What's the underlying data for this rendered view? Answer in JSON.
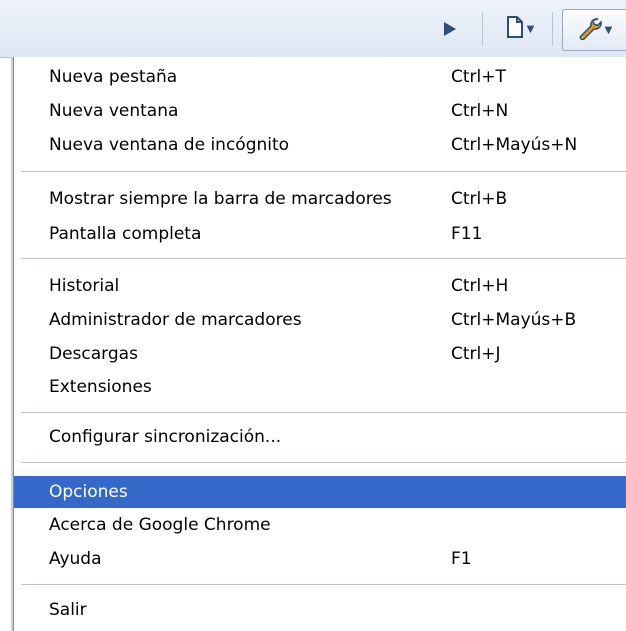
{
  "toolbar": {
    "icons": [
      "play-icon",
      "page-icon",
      "wrench-icon"
    ]
  },
  "menu": {
    "groups": [
      [
        {
          "label": "Nueva pestaña",
          "shortcut": "Ctrl+T"
        },
        {
          "label": "Nueva ventana",
          "shortcut": "Ctrl+N"
        },
        {
          "label": "Nueva ventana de incógnito",
          "shortcut": "Ctrl+Mayús+N"
        }
      ],
      [
        {
          "label": "Mostrar siempre la barra de marcadores",
          "shortcut": "Ctrl+B"
        },
        {
          "label": "Pantalla completa",
          "shortcut": "F11"
        }
      ],
      [
        {
          "label": "Historial",
          "shortcut": "Ctrl+H"
        },
        {
          "label": "Administrador de marcadores",
          "shortcut": "Ctrl+Mayús+B"
        },
        {
          "label": "Descargas",
          "shortcut": "Ctrl+J"
        },
        {
          "label": "Extensiones",
          "shortcut": ""
        }
      ],
      [
        {
          "label": "Configurar sincronización...",
          "shortcut": ""
        }
      ],
      [
        {
          "label": "Opciones",
          "shortcut": "",
          "highlighted": true
        },
        {
          "label": "Acerca de Google Chrome",
          "shortcut": ""
        },
        {
          "label": "Ayuda",
          "shortcut": "F1"
        }
      ],
      [
        {
          "label": "Salir",
          "shortcut": ""
        }
      ]
    ]
  },
  "colors": {
    "highlight": "#3569c9",
    "icon_blue": "#2b4e7a",
    "wrench_orange": "#e39a1f"
  }
}
